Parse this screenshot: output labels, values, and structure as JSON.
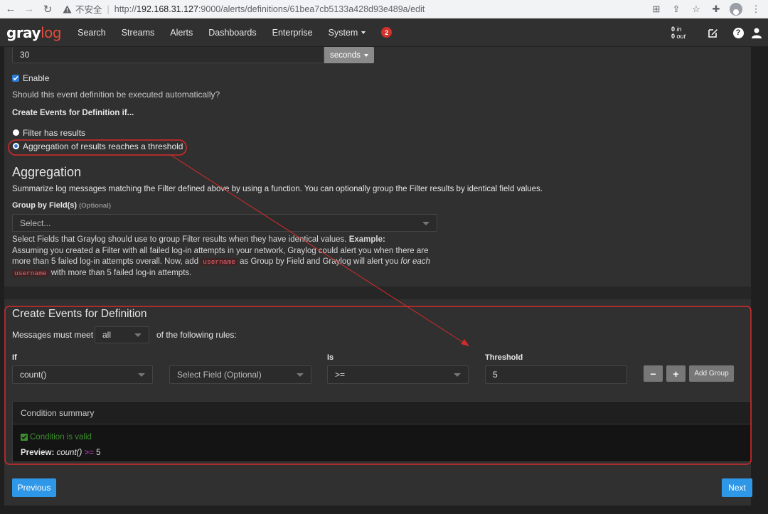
{
  "browser": {
    "insecure_label": "不安全",
    "url_prefix": "http://",
    "url_host": "192.168.31.127",
    "url_rest": ":9000/alerts/definitions/61bea7cb5133a428d93e489a/edit"
  },
  "navbar": {
    "logo_gray": "gray",
    "logo_log": "log",
    "items": [
      "Search",
      "Streams",
      "Alerts",
      "Dashboards",
      "Enterprise",
      "System"
    ],
    "notifications": "2",
    "throughput_in_value": "0",
    "throughput_in_label": "in",
    "throughput_out_value": "0",
    "throughput_out_label": "out"
  },
  "execution": {
    "interval_value": "30",
    "interval_unit": "seconds",
    "enable_label": "Enable",
    "help": "Should this event definition be executed automatically?"
  },
  "condition_type": {
    "heading": "Create Events for Definition if...",
    "option_filter": "Filter has results",
    "option_aggregation": "Aggregation of results reaches a threshold"
  },
  "aggregation": {
    "title": "Aggregation",
    "description": "Summarize log messages matching the Filter defined above by using a function. You can optionally group the Filter results by identical field values.",
    "group_by_label": "Group by Field(s)",
    "group_by_optional": "(Optional)",
    "group_by_placeholder": "Select...",
    "help_line1_a": "Select Fields that Graylog should use to group Filter results when they have identical values.",
    "help_line1_b": "Example:",
    "help_line2": "Assuming you created a Filter with all failed log-in attempts in your network, Graylog could alert you when there are",
    "help_line3_a": "more than 5 failed log-in attempts overall. Now, add",
    "help_code": "username",
    "help_line3_b": "as Group by Field and Graylog will alert you",
    "help_line3_c": "for each",
    "help_line4": "with more than 5 failed log-in attempts."
  },
  "definition": {
    "title": "Create Events for Definition",
    "meet_prefix": "Messages must meet",
    "meet_value": "all",
    "meet_suffix": "of the following rules:",
    "col_if": "If",
    "col_is": "Is",
    "col_threshold": "Threshold",
    "function": "count()",
    "field_placeholder": "Select Field (Optional)",
    "operator": ">=",
    "threshold": "5",
    "remove_label": "−",
    "add_label": "+",
    "add_group_label": "Add Group"
  },
  "summary": {
    "title": "Condition summary",
    "valid_text": "Condition is valid",
    "preview_label": "Preview:",
    "preview_fn": "count()",
    "preview_op": ">=",
    "preview_value": "5"
  },
  "footer": {
    "previous": "Previous",
    "next": "Next"
  },
  "colors": {
    "annotation_red": "#d42a2a",
    "primary_blue": "#2f97e8",
    "valid_green": "#3d8c2e",
    "brand_red": "#e64a3b"
  }
}
